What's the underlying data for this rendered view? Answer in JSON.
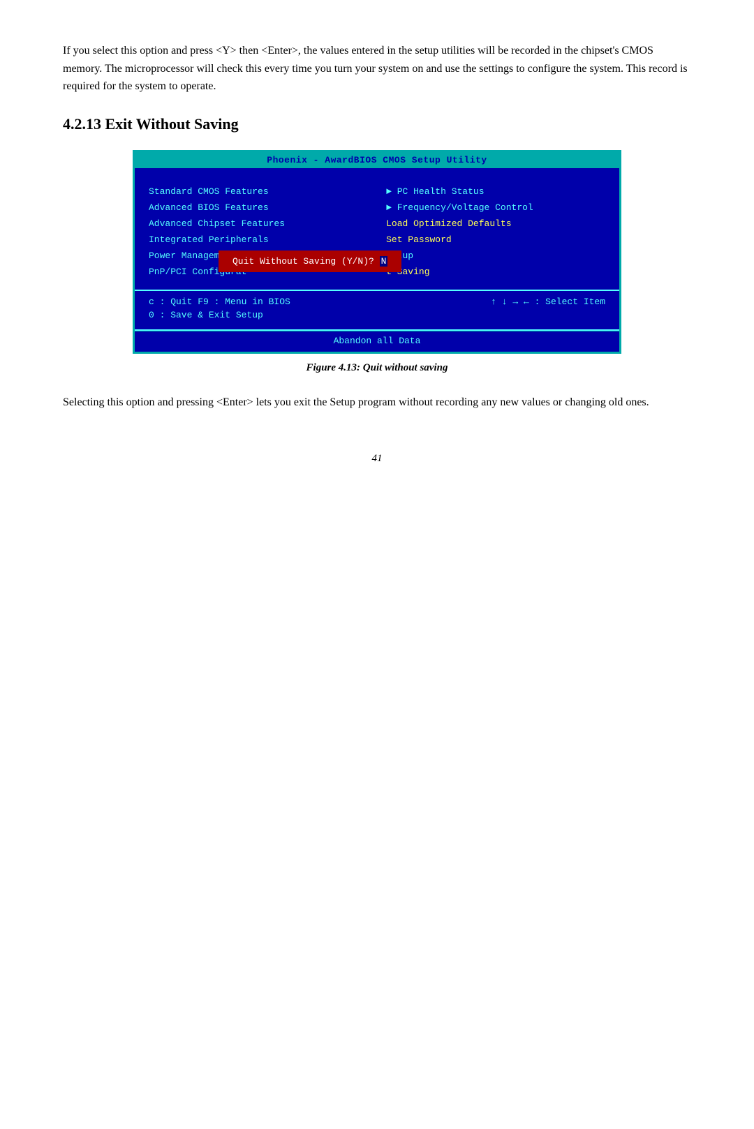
{
  "intro": {
    "paragraph": "If you select this option and press <Y> then <Enter>, the values entered in the setup utilities will be recorded in the chipset's CMOS memory. The microprocessor will check this every time you turn your system on and use the settings to configure the system. This record is required for the system to operate."
  },
  "section": {
    "heading": "4.2.13 Exit Without Saving"
  },
  "bios": {
    "title": "Phoenix - AwardBIOS CMOS Setup Utility",
    "menu_left": [
      "Standard CMOS Features",
      "Advanced BIOS Features",
      "Advanced Chipset Features",
      "Integrated Peripherals",
      "Power Management S",
      "PnP/PCI Configurat"
    ],
    "menu_right": [
      "► PC Health Status",
      "► Frequency/Voltage Control",
      "Load Optimized Defaults",
      "Set Password",
      "Setup",
      "t Saving"
    ],
    "dialog": {
      "text": "Quit Without Saving (Y/N)?",
      "value": "N"
    },
    "footer_left_line1": "c : Quit      F9 : Menu in BIOS",
    "footer_left_line2": "0 : Save & Exit Setup",
    "footer_right": "↑ ↓ → ←  : Select Item",
    "bottom_bar": "Abandon all Data"
  },
  "figure": {
    "caption": "Figure 4.13: Quit without saving"
  },
  "body_text": "Selecting this option and pressing <Enter> lets you exit the Setup program without recording any new values or changing old ones.",
  "page_number": "41"
}
